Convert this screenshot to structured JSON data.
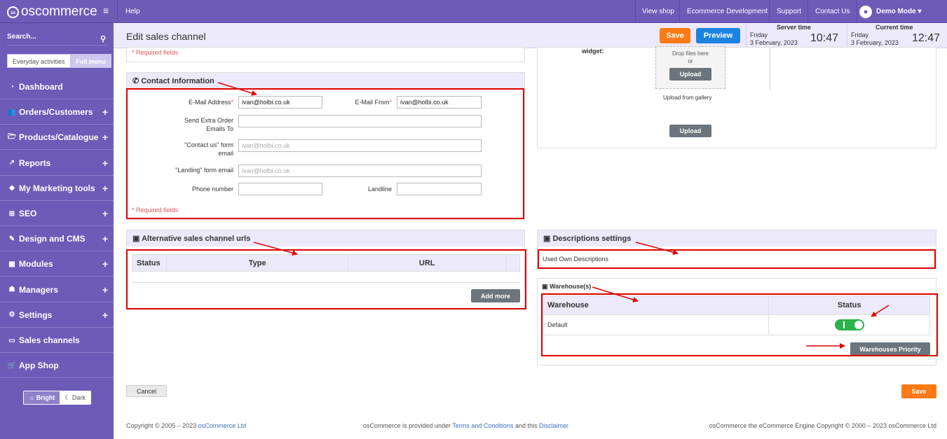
{
  "app": {
    "logo": "oscommerce",
    "logo_mark": "ω"
  },
  "topbar": {
    "help": "Help",
    "links": [
      "View shop",
      "Ecommerce Development",
      "Support",
      "Contact Us"
    ],
    "user": "Demo Mode ▾"
  },
  "sidebar": {
    "search_label": "Search...",
    "mode_tabs": [
      "Everyday activities",
      "Full menu"
    ],
    "items": [
      {
        "label": "Dashboard",
        "icon": "dashboard-icon",
        "expand": ""
      },
      {
        "label": "Orders/Customers",
        "icon": "users-icon",
        "expand": "+"
      },
      {
        "label": "Products/Catalogue",
        "icon": "folder-icon",
        "expand": "+"
      },
      {
        "label": "Reports",
        "icon": "chart-icon",
        "expand": "+"
      },
      {
        "label": "My Marketing tools",
        "icon": "tag-icon",
        "expand": "+"
      },
      {
        "label": "SEO",
        "icon": "sitemap-icon",
        "expand": "+"
      },
      {
        "label": "Design and CMS",
        "icon": "brush-icon",
        "expand": "+"
      },
      {
        "label": "Modules",
        "icon": "modules-icon",
        "expand": "+"
      },
      {
        "label": "Managers",
        "icon": "user-icon",
        "expand": "+"
      },
      {
        "label": "Settings",
        "icon": "gears-icon",
        "expand": "+"
      },
      {
        "label": "Sales channels",
        "icon": "monitor-icon",
        "expand": ""
      },
      {
        "label": "App Shop",
        "icon": "cart-icon",
        "expand": ""
      }
    ],
    "theme": {
      "bright": "Bright",
      "dark": "Dark"
    }
  },
  "header": {
    "title": "Edit sales channel",
    "save": "Save",
    "preview": "Preview",
    "server_time": {
      "label": "Server time",
      "day": "Friday",
      "date": "3 February, 2023",
      "time": "10:47"
    },
    "current_time": {
      "label": "Current time",
      "day": "Friday",
      "date": "3 February, 2023",
      "time": "12:47"
    }
  },
  "top_left_panel": {
    "required": "* Required fields"
  },
  "widget_panel": {
    "label": "widget:",
    "drop_text": "Drop files here",
    "or": "or",
    "upload": "Upload",
    "upload_gallery": "Upload from gallery",
    "upload2": "Upload"
  },
  "contact": {
    "title": "Contact Information",
    "email_label": "E-Mail Address",
    "email_value": "ivan@holbi.co.uk",
    "email_from_label": "E-Mail From",
    "email_from_value": "ivan@holbi.co.uk",
    "extra_label": "Send Extra Order Emails To",
    "extra_value": "",
    "contactus_label": "\"Contact us\" form email",
    "contactus_placeholder": "ivan@holbi.co.uk",
    "landing_label": "\"Landing\" form email",
    "landing_placeholder": "ivan@holbi.co.uk",
    "phone_label": "Phone number",
    "phone_value": "",
    "landline_label": "Landline",
    "landline_value": "",
    "required": "* Required fields",
    "asterisk": "*"
  },
  "alt_urls": {
    "title": "Alternative sales channel urls",
    "columns": [
      "Status",
      "Type",
      "URL"
    ],
    "add_more": "Add more"
  },
  "descriptions": {
    "title": "Descriptions settings",
    "value": "Used Own Descriptions"
  },
  "warehouses": {
    "title": "Warehouse(s)",
    "columns": [
      "Warehouse",
      "Status"
    ],
    "rows": [
      {
        "name": "Default",
        "status_on": true
      }
    ],
    "priority_button": "Warehouses Priority"
  },
  "actions": {
    "cancel": "Cancel",
    "save": "Save"
  },
  "footer": {
    "copyright": "Copyright © 2005 – 2023",
    "copyright_link": "osCommerce Ltd",
    "mid_text": "osCommerce is provided under",
    "terms": "Terms and Conditions",
    "and_this": "and this",
    "disclaimer": "Disclaimer",
    "right": "osCommerce the eCommerce Engine Copyright © 2000 – 2023 osCommerce Ltd"
  },
  "colors": {
    "brand": "#6d5bb8",
    "save": "#ff7a14",
    "preview": "#1c84e0",
    "toggle_on": "#2bb24c",
    "annotation": "#e00000"
  }
}
